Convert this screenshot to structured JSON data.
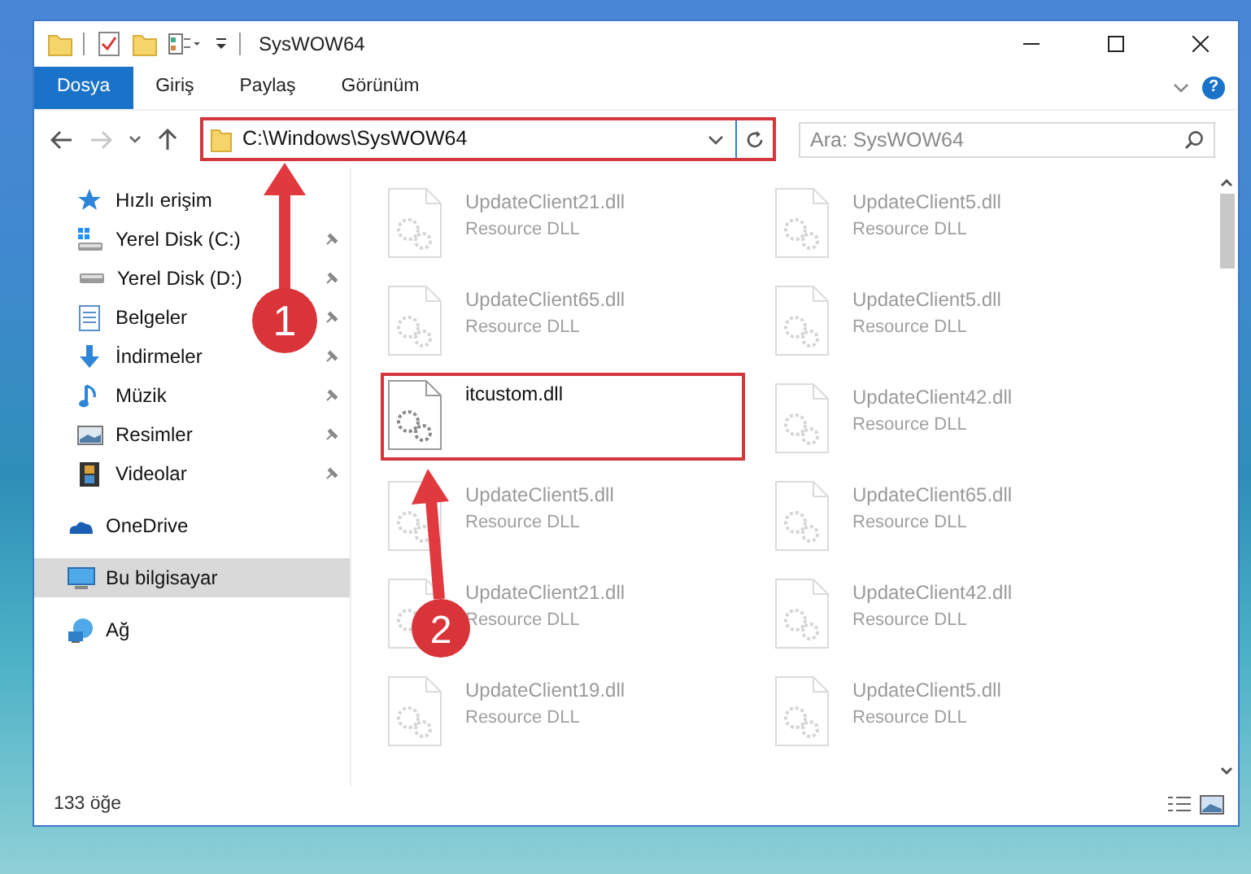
{
  "window": {
    "title": "SysWOW64"
  },
  "ribbon": {
    "tabs": [
      {
        "label": "Dosya",
        "selected": true
      },
      {
        "label": "Giriş",
        "selected": false
      },
      {
        "label": "Paylaş",
        "selected": false
      },
      {
        "label": "Görünüm",
        "selected": false
      }
    ],
    "help": "?"
  },
  "navigation": {
    "forward_disabled": true,
    "address": "C:\\Windows\\SysWOW64",
    "search_placeholder": "Ara: SysWOW64"
  },
  "sidebar": {
    "items": [
      {
        "label": "Hızlı erişim",
        "kind": "star",
        "pinned": false,
        "selected": false,
        "children": [
          {
            "label": "Yerel Disk (C:)",
            "kind": "drive-windows",
            "pinned": true,
            "selected": false
          },
          {
            "label": "Yerel Disk (D:)",
            "kind": "drive",
            "pinned": true,
            "selected": false
          },
          {
            "label": "Belgeler",
            "kind": "document",
            "pinned": true,
            "selected": false
          },
          {
            "label": "İndirmeler",
            "kind": "download",
            "pinned": true,
            "selected": false
          },
          {
            "label": "Müzik",
            "kind": "music",
            "pinned": true,
            "selected": false
          },
          {
            "label": "Resimler",
            "kind": "picture",
            "pinned": true,
            "selected": false
          },
          {
            "label": "Videolar",
            "kind": "video",
            "pinned": true,
            "selected": false
          }
        ]
      },
      {
        "label": "OneDrive",
        "kind": "cloud",
        "pinned": false,
        "selected": false
      },
      {
        "label": "Bu bilgisayar",
        "kind": "computer",
        "pinned": false,
        "selected": true
      },
      {
        "label": "Ağ",
        "kind": "network",
        "pinned": false,
        "selected": false
      }
    ]
  },
  "files": [
    {
      "name": "UpdateClient21.dll",
      "type": "Resource DLL",
      "kind": "faded"
    },
    {
      "name": "UpdateClient5.dll",
      "type": "Resource DLL",
      "kind": "faded"
    },
    {
      "name": "UpdateClient65.dll",
      "type": "Resource DLL",
      "kind": "faded"
    },
    {
      "name": "UpdateClient5.dll",
      "type": "Resource DLL",
      "kind": "faded"
    },
    {
      "name": "itcustom.dll",
      "kind": "highlighted"
    },
    {
      "name": "UpdateClient42.dll",
      "type": "Resource DLL",
      "kind": "faded"
    },
    {
      "name": "UpdateClient5.dll",
      "type": "Resource DLL",
      "kind": "faded"
    },
    {
      "name": "UpdateClient65.dll",
      "type": "Resource DLL",
      "kind": "faded"
    },
    {
      "name": "UpdateClient21.dll",
      "type": "Resource DLL",
      "kind": "faded"
    },
    {
      "name": "UpdateClient42.dll",
      "type": "Resource DLL",
      "kind": "faded"
    },
    {
      "name": "UpdateClient19.dll",
      "type": "Resource DLL",
      "kind": "faded"
    },
    {
      "name": "UpdateClient5.dll",
      "type": "Resource DLL",
      "kind": "faded"
    }
  ],
  "status_bar": {
    "item_count": "133 öğe"
  },
  "annotations": [
    {
      "number": "1"
    },
    {
      "number": "2"
    }
  ]
}
